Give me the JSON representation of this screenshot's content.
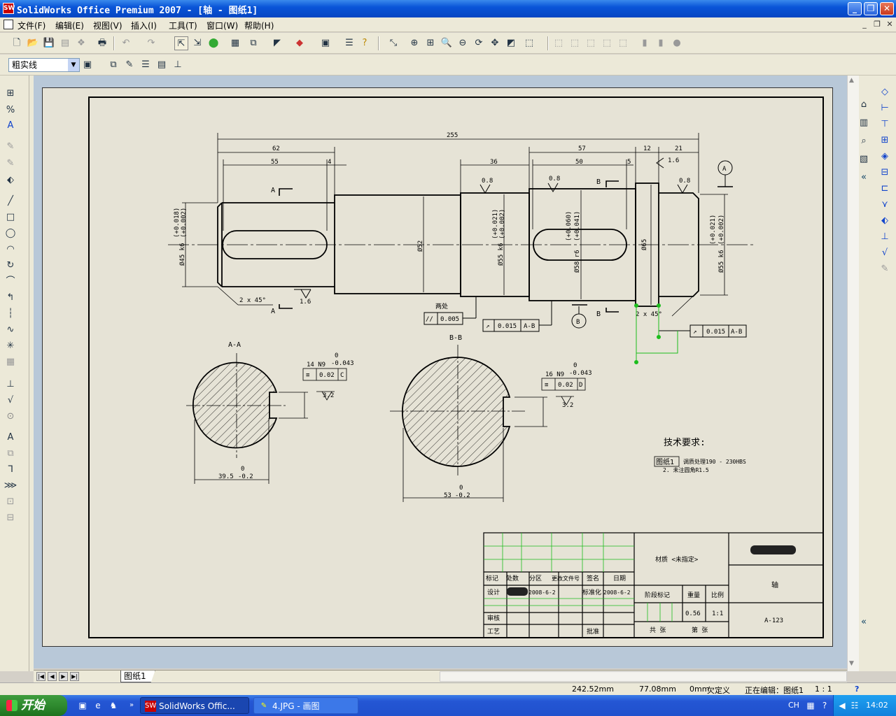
{
  "window": {
    "title": "SolidWorks Office Premium 2007 - [轴 - 图纸1]",
    "logo": "SW",
    "minimize_icon": "_",
    "maximize_icon": "❐",
    "close_icon": "✕"
  },
  "menu": {
    "items": [
      "文件(F)",
      "编辑(E)",
      "视图(V)",
      "插入(I)",
      "工具(T)",
      "窗口(W)",
      "帮助(H)"
    ],
    "mdi_minimize": "_",
    "mdi_restore": "❐",
    "mdi_close": "✕"
  },
  "toolbar_icons": {
    "new": "🗋",
    "open": "📂",
    "save": "💾",
    "print": "🖶",
    "undo": "↶",
    "redo": "↷",
    "select": "⇱",
    "rebuild": "⬤",
    "options": "☰",
    "help": "?",
    "zoom_fit": "⊕",
    "zoom_area": "⊞",
    "zoom_in": "🔍",
    "zoom_out": "⊖",
    "rotate": "⟳",
    "pan": "✥",
    "view": "⬚"
  },
  "line_format": {
    "layer_value": "粗实线"
  },
  "drawing": {
    "sheet_name": "图纸1",
    "dims": {
      "overall": "255",
      "d62": "62",
      "d55": "55",
      "d4": "4",
      "d36": "36",
      "d57": "57",
      "d50": "50",
      "d5": "5",
      "d12": "12",
      "d21": "21",
      "dia45": "Ø45 k6",
      "dia45_tol_upper": "(+0.018)",
      "dia45_tol_lower": "(+0.002)",
      "dia52": "Ø52",
      "dia55a": "Ø55 k6",
      "dia55a_tol_upper": "(+0.021)",
      "dia55a_tol_lower": "(+0.002)",
      "dia58": "Ø58 r6",
      "dia58_tol_upper": "(+0.060)",
      "dia58_tol_lower": "(+0.041)",
      "dia65": "Ø65",
      "dia55b": "Ø55 k6",
      "dia55b_tol_upper": "(+0.021)",
      "dia55b_tol_lower": "(+0.002)",
      "chamfer_left": "2 x 45°",
      "chamfer_right": "2 x 45°",
      "rough_16": "1.6",
      "rough_08a": "0.8",
      "rough_08b": "0.8",
      "rough_08c": "0.8",
      "rough_16b": "1.6"
    },
    "section_labels": {
      "a_top": "A",
      "a_bottom": "A",
      "b_top": "B",
      "b_bottom": "B",
      "datum_a": "A",
      "datum_b": "B",
      "view_aa": "A-A",
      "view_bb": "B-B"
    },
    "gdt": {
      "both_ends": "两处",
      "parallel_sym": "//",
      "parallel_val": "0.005",
      "runout1_sym": "↗",
      "runout1_val": "0.015",
      "runout1_ref": "A-B",
      "runout2_sym": "↗",
      "runout2_val": "0.015",
      "runout2_ref": "A-B",
      "sym_aa_sym": "≡",
      "sym_aa_val": "0.02",
      "sym_aa_ref": "C",
      "sym_bb_sym": "≡",
      "sym_bb_val": "0.02",
      "sym_bb_ref": "D"
    },
    "section_aa": {
      "keyway": "14 N9",
      "keyway_upper": "0",
      "keyway_lower": "-0.043",
      "roughness": "3.2",
      "depth": "39.5",
      "depth_upper": "0",
      "depth_lower": "-0.2"
    },
    "section_bb": {
      "keyway": "16 N9",
      "keyway_upper": "0",
      "keyway_lower": "-0.043",
      "roughness": "3.2",
      "depth": "53",
      "depth_upper": "0",
      "depth_lower": "-0.2"
    },
    "tech_req": {
      "heading": "技术要求:",
      "tag": "图纸1",
      "line1": "调质处理190 - 230HBS",
      "line2": "2.  未注圆角R1.5"
    },
    "title_block": {
      "material": "材质 <未指定>",
      "part_name": "轴",
      "drawing_no": "A-123",
      "col_mark": "标记",
      "col_count": "处数",
      "col_zone": "分区",
      "col_docno": "更改文件号",
      "col_sign": "签名",
      "col_date": "日期",
      "designer": "设计",
      "design_date": "2008-6-2",
      "standard": "标准化",
      "std_date": "2008-6-2",
      "stage": "阶段标记",
      "weight": "重量",
      "scale": "比例",
      "weight_val": "0.56",
      "scale_val": "1:1",
      "check": "审核",
      "process": "工艺",
      "approve": "批准",
      "total": "共  张",
      "sheet": "第  张"
    }
  },
  "status": {
    "x": "242.52mm",
    "y": "77.08mm",
    "z": "0mm",
    "state": "欠定义",
    "editing": "正在编辑：图纸1",
    "scale": "1 : 1",
    "help": "?"
  },
  "taskbar": {
    "start": "开始",
    "tasks": [
      {
        "label": "SolidWorks Offic...",
        "icon": "SW"
      },
      {
        "label": "4.JPG - 画图",
        "icon": "✎"
      }
    ],
    "lang": "CH",
    "clock": "14:02"
  }
}
